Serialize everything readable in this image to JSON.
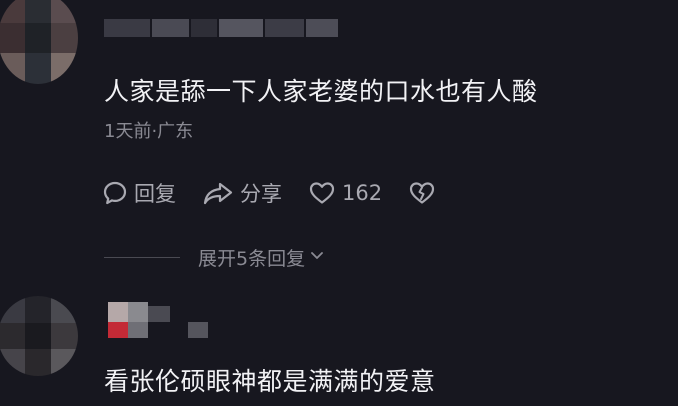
{
  "comments": [
    {
      "text": "人家是舔一下人家老婆的口水也有人酸",
      "meta": "1天前·广东",
      "actions": {
        "reply_label": "回复",
        "share_label": "分享",
        "like_count": "162"
      },
      "expand_label": "展开5条回复"
    },
    {
      "text": "看张伦硕眼神都是满满的爱意"
    }
  ],
  "icons": {
    "reply": "speech-bubble-icon",
    "share": "share-arrow-icon",
    "like": "heart-icon",
    "dislike": "broken-heart-icon",
    "expand": "chevron-down-icon"
  },
  "colors": {
    "background": "#17171f",
    "text_primary": "#f2f2f5",
    "text_secondary": "#8a8a93",
    "action_text": "#a9a9b1"
  }
}
